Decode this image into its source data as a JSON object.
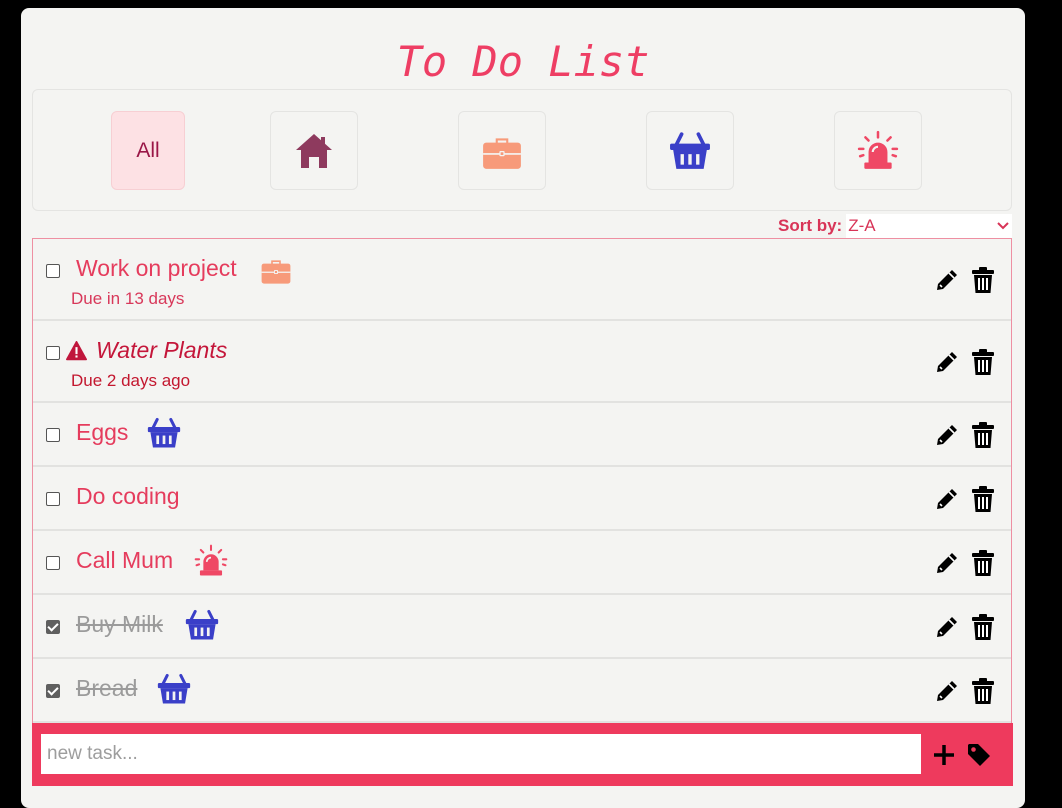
{
  "app": {
    "title": "To Do List"
  },
  "filters": [
    {
      "id": "all",
      "label": "All",
      "active": true
    },
    {
      "id": "home",
      "icon": "house-icon",
      "color": "#8e3a5e"
    },
    {
      "id": "work",
      "icon": "briefcase-icon",
      "color": "#f79a7a"
    },
    {
      "id": "shopping",
      "icon": "basket-icon",
      "color": "#3a3fc8"
    },
    {
      "id": "urgent",
      "icon": "siren-icon",
      "color": "#ef4865"
    }
  ],
  "sort": {
    "label": "Sort by:",
    "value": "Z-A"
  },
  "tasks": [
    {
      "name": "Work on project",
      "due": "Due in 13 days",
      "category": "work",
      "done": false
    },
    {
      "name": "Water Plants",
      "due": "Due 2 days ago",
      "overdue": true,
      "done": false
    },
    {
      "name": "Eggs",
      "category": "shopping",
      "done": false
    },
    {
      "name": "Do coding",
      "done": false
    },
    {
      "name": "Call Mum",
      "category": "urgent",
      "done": false
    },
    {
      "name": "Buy Milk",
      "category": "shopping",
      "done": true
    },
    {
      "name": "Bread",
      "category": "shopping",
      "done": true
    }
  ],
  "add": {
    "placeholder": "new task..."
  },
  "colors": {
    "accent": "#ee3e64",
    "background": "#f4f4f2",
    "active_filter": "#fde1e4"
  }
}
